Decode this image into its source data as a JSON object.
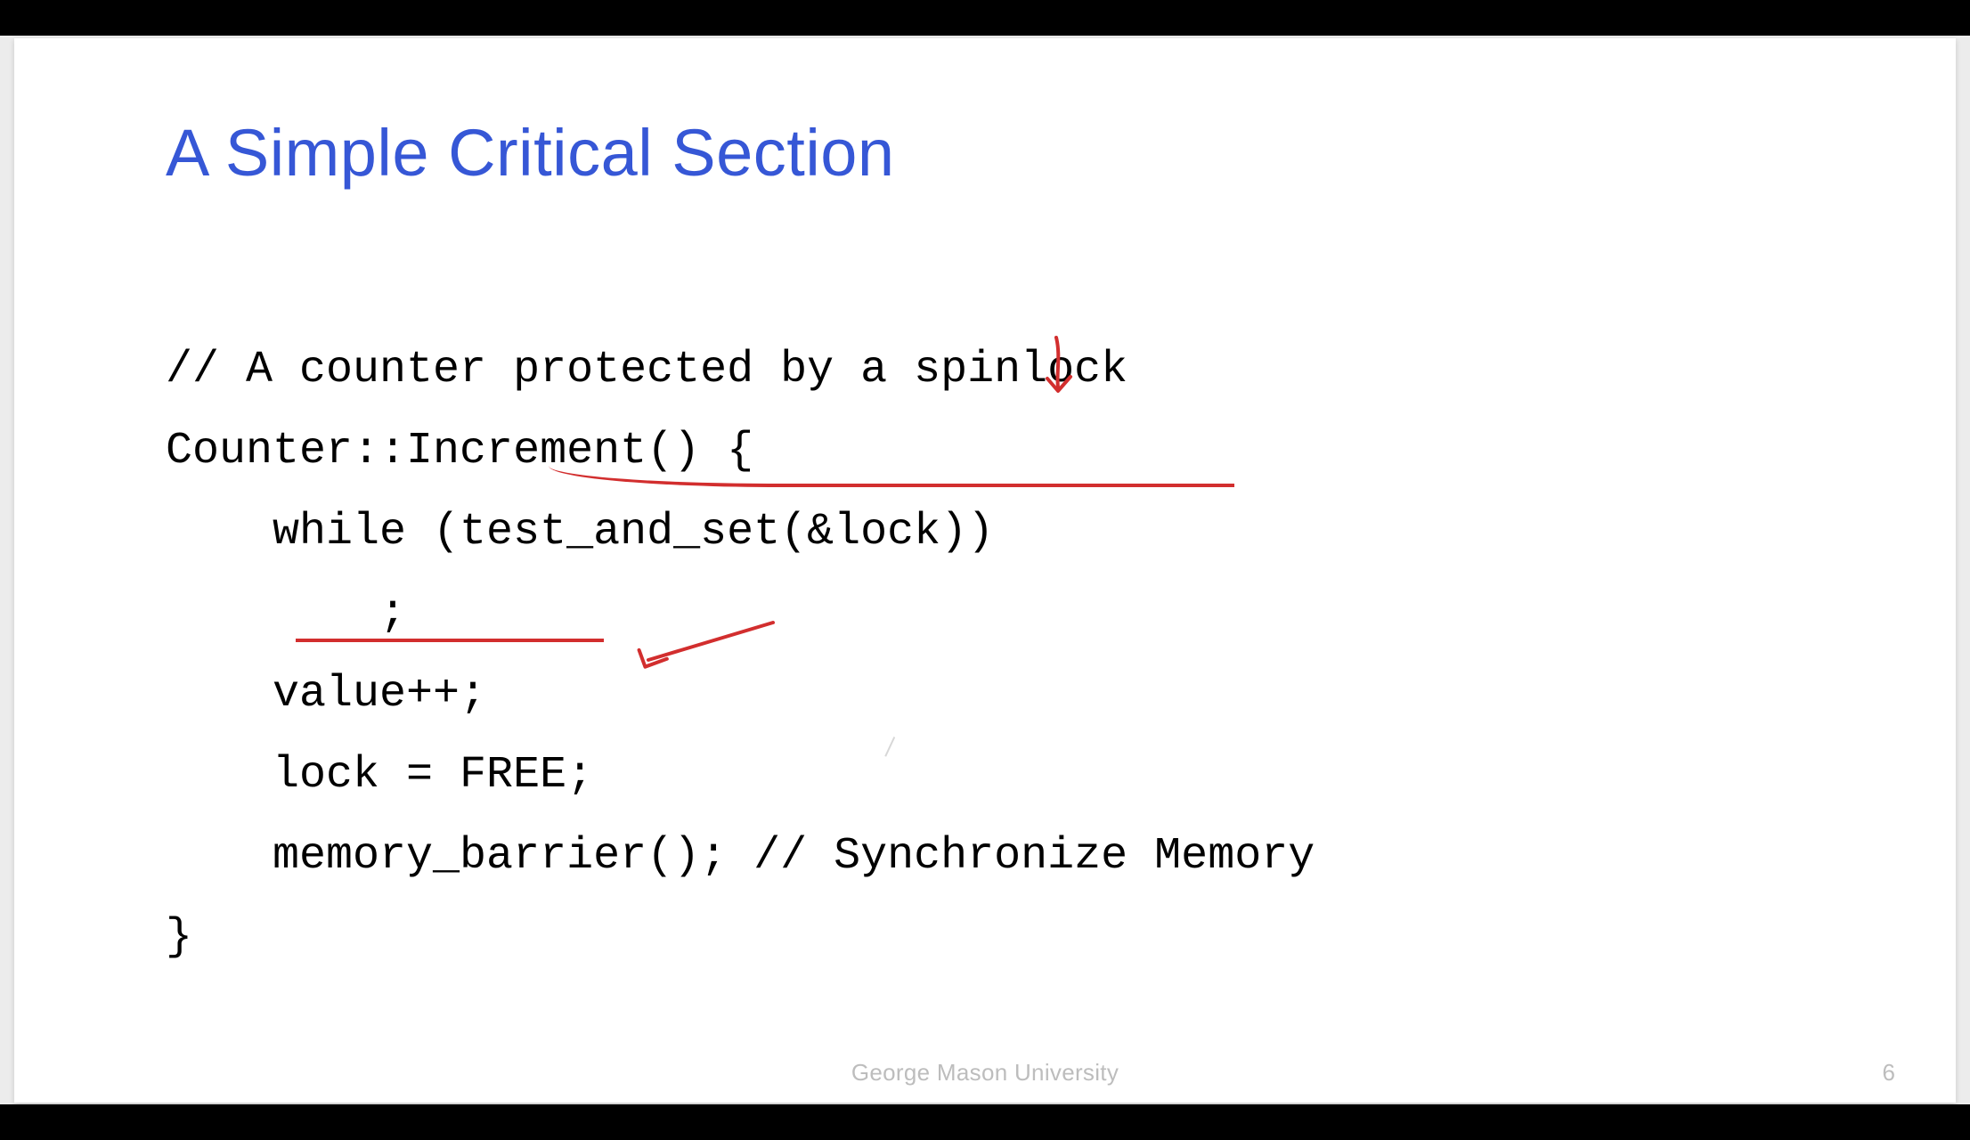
{
  "slide": {
    "title": "A Simple Critical Section",
    "code_lines": [
      "// A counter protected by a spinlock",
      "Counter::Increment() {",
      "    while (test_and_set(&lock))",
      "        ;",
      "    value++;",
      "    lock = FREE;",
      "    memory_barrier(); // Synchronize Memory",
      "}"
    ],
    "footer": "George Mason University",
    "page_number": "6"
  },
  "annotations": {
    "color": "#d22e2e",
    "marks": [
      "down-arrow-over-lock",
      "underline-test_and_set-call",
      "underline-value++",
      "arrow-pointing-at-FREE"
    ]
  }
}
